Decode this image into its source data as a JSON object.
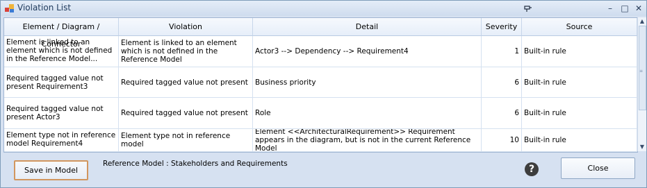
{
  "window": {
    "title": "Violation List"
  },
  "table": {
    "headers": [
      "Element / Diagram / Connector",
      "Violation",
      "Detail",
      "Severity",
      "Source"
    ],
    "rows": [
      {
        "element": "Element is linked to an element which is not defined in the Reference Model...",
        "violation": "Element is linked to an element which is not defined in the Reference Model",
        "detail": "Actor3 --> Dependency --> Requirement4",
        "severity": "1",
        "source": "Built-in rule"
      },
      {
        "element": "Required tagged value not present Requirement3",
        "violation": "Required tagged value not present",
        "detail": "Business priority",
        "severity": "6",
        "source": "Built-in rule"
      },
      {
        "element": "Required tagged value not present Actor3",
        "violation": "Required tagged value not present",
        "detail": "Role",
        "severity": "6",
        "source": "Built-in rule"
      },
      {
        "element": "Element type not in reference model Requirement4",
        "violation": "Element type not in reference model",
        "detail": "Element <<ArchitecturalRequirement>> Requirement  appears in the diagram, but is not in the current Reference Model",
        "severity": "10",
        "source": "Built-in rule"
      }
    ]
  },
  "footer": {
    "save_label": "Save in Model",
    "reference_model": "Reference Model : Stakeholders and Requirements",
    "help_glyph": "?",
    "close_label": "Close"
  },
  "colors": {
    "accent_border": "#d2965e",
    "frame": "#d6e1f1"
  },
  "icons": [
    "app-icon",
    "pin-icon",
    "minimize-icon",
    "maximize-icon",
    "close-icon",
    "help-icon"
  ]
}
